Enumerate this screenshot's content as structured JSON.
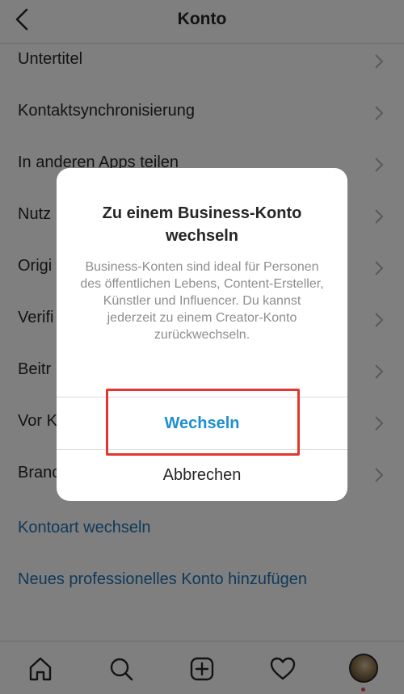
{
  "header": {
    "title": "Konto",
    "back_icon": "chevron-left-icon"
  },
  "menu": {
    "items": [
      {
        "label": "Untertitel"
      },
      {
        "label": "Kontaktsynchronisierung"
      },
      {
        "label": "In anderen Apps teilen"
      },
      {
        "label": "Nutz"
      },
      {
        "label": "Origi"
      },
      {
        "label": "Verifi"
      },
      {
        "label": "Beitr"
      },
      {
        "label": "Vor K"
      },
      {
        "label": "Branc"
      }
    ],
    "link_switch": "Kontoart wechseln",
    "link_add": "Neues professionelles Konto hinzufügen"
  },
  "dialog": {
    "title": "Zu einem Business-Konto wechseln",
    "body": "Business-Konten sind ideal für Personen des öffentlichen Lebens, Content-Ersteller, Künstler und Influencer. Du kannst jederzeit zu einem Creator-Konto zurückwechseln.",
    "confirm_label": "Wechseln",
    "cancel_label": "Abbrechen"
  },
  "tabbar": {
    "tabs": [
      {
        "icon": "home-icon"
      },
      {
        "icon": "search-icon"
      },
      {
        "icon": "new-post-icon"
      },
      {
        "icon": "heart-icon"
      },
      {
        "icon": "profile-avatar"
      }
    ]
  },
  "colors": {
    "link": "#1e73b4",
    "dialog_primary": "#1e8fd1",
    "highlight": "#e3342f",
    "notification_dot": "#ed4956"
  }
}
